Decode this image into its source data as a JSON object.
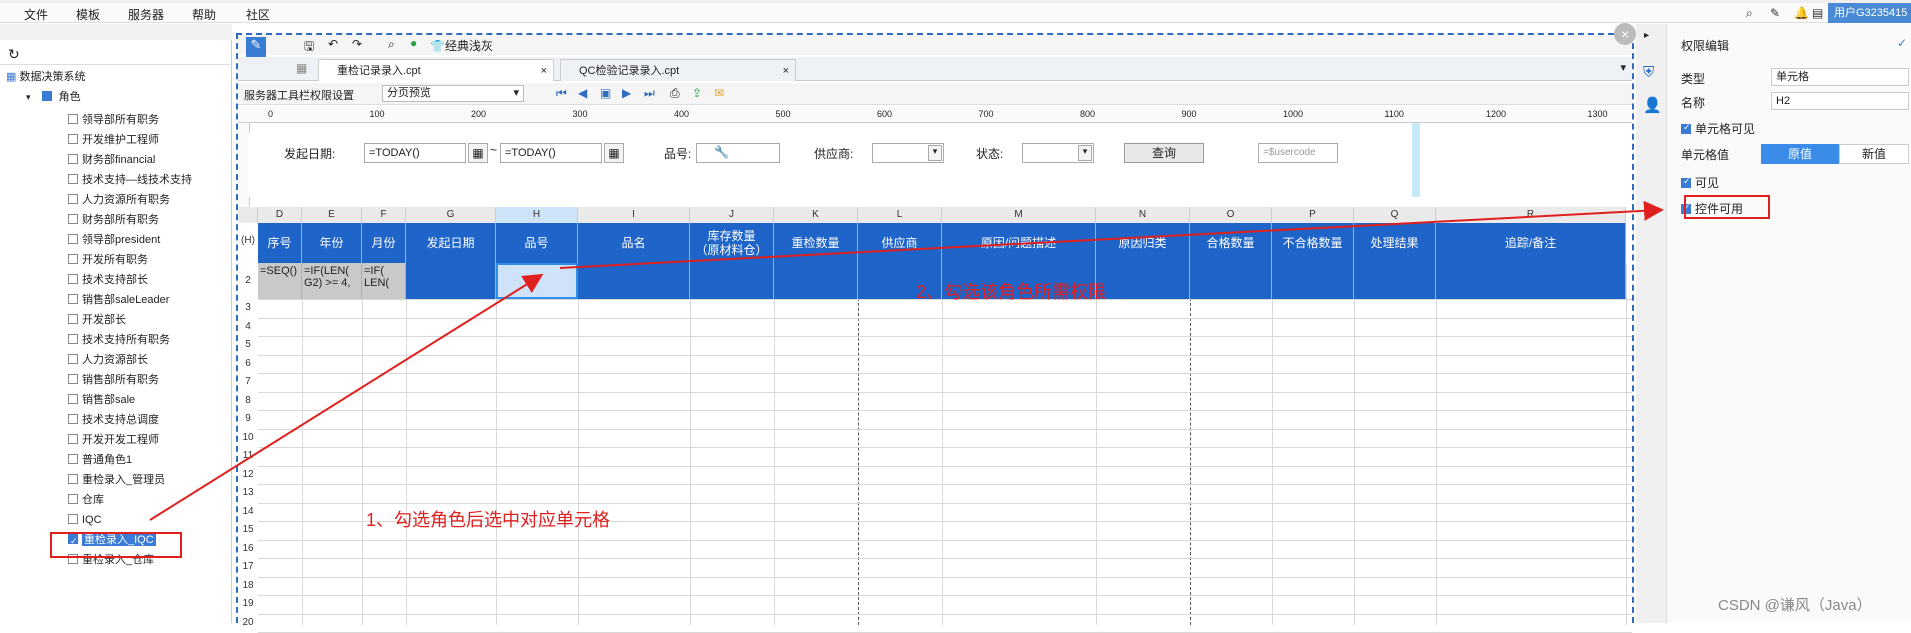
{
  "menubar": {
    "items": [
      "文件",
      "模板",
      "服务器",
      "帮助",
      "社区"
    ],
    "user": "用户G3235415"
  },
  "left_panel": {
    "root": "数据决策系统",
    "role_group": "角色",
    "roles": [
      {
        "label": "领导部所有职务",
        "checked": false
      },
      {
        "label": "开发维护工程师",
        "checked": false
      },
      {
        "label": "财务部financial",
        "checked": false
      },
      {
        "label": "技术支持—线技术支持",
        "checked": false
      },
      {
        "label": "人力资源所有职务",
        "checked": false
      },
      {
        "label": "财务部所有职务",
        "checked": false
      },
      {
        "label": "领导部president",
        "checked": false
      },
      {
        "label": "开发所有职务",
        "checked": false
      },
      {
        "label": "技术支持部长",
        "checked": false
      },
      {
        "label": "销售部saleLeader",
        "checked": false
      },
      {
        "label": "开发部长",
        "checked": false
      },
      {
        "label": "技术支持所有职务",
        "checked": false
      },
      {
        "label": "人力资源部长",
        "checked": false
      },
      {
        "label": "销售部所有职务",
        "checked": false
      },
      {
        "label": "销售部sale",
        "checked": false
      },
      {
        "label": "技术支持总调度",
        "checked": false
      },
      {
        "label": "开发开发工程师",
        "checked": false
      },
      {
        "label": "普通角色1",
        "checked": false
      },
      {
        "label": "重检录入_管理员",
        "checked": false
      },
      {
        "label": "仓库",
        "checked": false
      },
      {
        "label": "IQC",
        "checked": false
      },
      {
        "label": "重检录入_IQC",
        "checked": true
      },
      {
        "label": "重检录入_仓库",
        "checked": false
      }
    ]
  },
  "designer": {
    "theme_label": "经典浅灰",
    "tabs": [
      "重检记录录入.cpt",
      "QC检验记录录入.cpt"
    ],
    "toolbar_perm_label": "服务器工具栏权限设置",
    "pagination_select": "分页预览",
    "ruler_ticks": [
      "0",
      "100",
      "200",
      "300",
      "400",
      "500",
      "600",
      "700",
      "800",
      "900",
      "1000",
      "1100",
      "1200",
      "1300"
    ],
    "params": {
      "start_date_label": "发起日期:",
      "start_date_from": "=TODAY()",
      "tilde": "~",
      "start_date_to": "=TODAY()",
      "part_no_label": "品号:",
      "supplier_label": "供应商:",
      "status_label": "状态:",
      "query_button": "查询",
      "usercode_placeholder": "=$usercode"
    },
    "columns": [
      "D",
      "E",
      "F",
      "G",
      "H",
      "I",
      "J",
      "K",
      "L",
      "M",
      "N",
      "O",
      "P",
      "Q",
      "R"
    ],
    "header_row_label": "(H)",
    "headers": [
      "序号",
      "年份",
      "月份",
      "发起日期",
      "品号",
      "品名",
      "库存数量\n（原材料仓）",
      "重检数量",
      "供应商",
      "原因/问题描述",
      "原因归类",
      "合格数量",
      "不合格数量",
      "处理结果",
      "追踪/备注"
    ],
    "row2": {
      "D": "=SEQ()",
      "E": "=IF(LEN(\nG2) >= 4,",
      "F": "=IF(\nLEN("
    },
    "row_numbers": [
      "2",
      "3",
      "4",
      "5",
      "6",
      "7",
      "8",
      "9",
      "10",
      "11",
      "12",
      "13",
      "14",
      "15",
      "16",
      "17",
      "18",
      "19",
      "20"
    ]
  },
  "right_panel": {
    "title": "权限编辑",
    "type_label": "类型",
    "type_value": "单元格",
    "name_label": "名称",
    "name_value": "H2",
    "cell_visible": "单元格可见",
    "cell_value_label": "单元格值",
    "seg_original": "原值",
    "seg_new": "新值",
    "visible": "可见",
    "control_enabled": "控件可用"
  },
  "annotations": {
    "step1": "1、勾选角色后选中对应单元格",
    "step2": "2、勾选该角色所需权限",
    "watermark": "CSDN @谦风（Java）",
    "color": "#e0201e"
  }
}
